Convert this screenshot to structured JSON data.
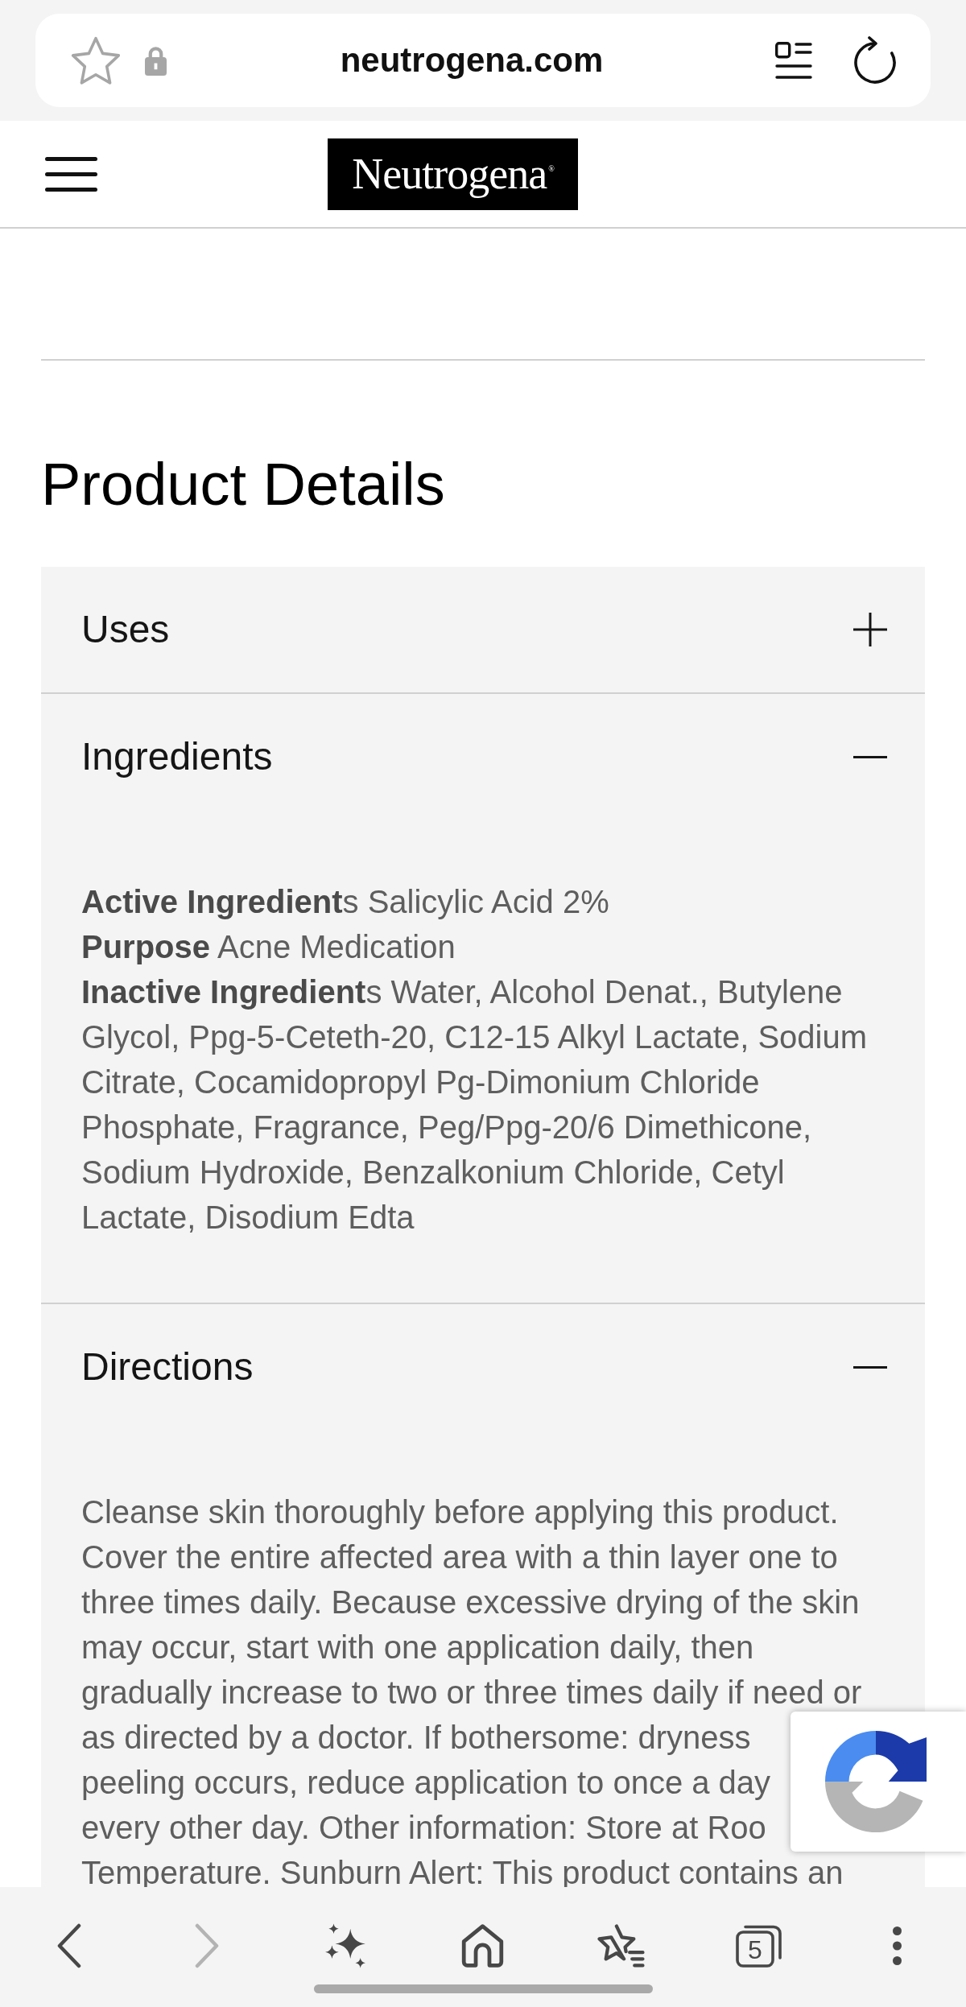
{
  "browser": {
    "url": "neutrogena.com"
  },
  "site_header": {
    "logo": "Neutrogena$^{®}$"
  },
  "heading": "Product Details",
  "sections": [
    {
      "title": "Uses",
      "expanded": false
    },
    {
      "title": "Ingredients",
      "expanded": true,
      "body": [
        "**Active Ingredient**s Salicylic Acid 2%",
        "**Purpose** Acne Medication",
        "**Inactive Ingredient**s Water, Alcohol Denat., Butylene Glycol, Ppg-5-Ceteth-20, C12-15 Alkyl Lactate, Sodium Citrate, Cocamidopropyl Pg-Dimonium Chloride Phosphate, Fragrance, Peg/Ppg-20/6 Dimethicone, Sodium Hydroxide, Benzalkonium Chloride, Cetyl Lactate, Disodium Edta"
      ]
    },
    {
      "title": "Directions",
      "expanded": true,
      "body": [
        "Cleanse skin thoroughly before applying this product.",
        "Cover the entire affected area with a thin layer one to",
        "three times daily. Because excessive drying of the skin",
        "may occur, start with one application daily, then",
        "gradually increase to two or three times daily if need or",
        "as directed by a doctor. If bothersome: dryness",
        "peeling occurs, reduce application to once a day",
        "every other day. Other information: Store at Roo",
        "Temperature. Sunburn Alert: This product contains an"
      ]
    }
  ],
  "bottom_toolbar": [
    {
      "kind": "back",
      "disabled": false
    },
    {
      "kind": "forward",
      "disabled": true
    },
    {
      "kind": "assistant"
    },
    {
      "kind": "home"
    },
    {
      "kind": "bookmarks"
    },
    {
      "kind": "tabs",
      "count": "5"
    },
    {
      "kind": "more"
    }
  ]
}
